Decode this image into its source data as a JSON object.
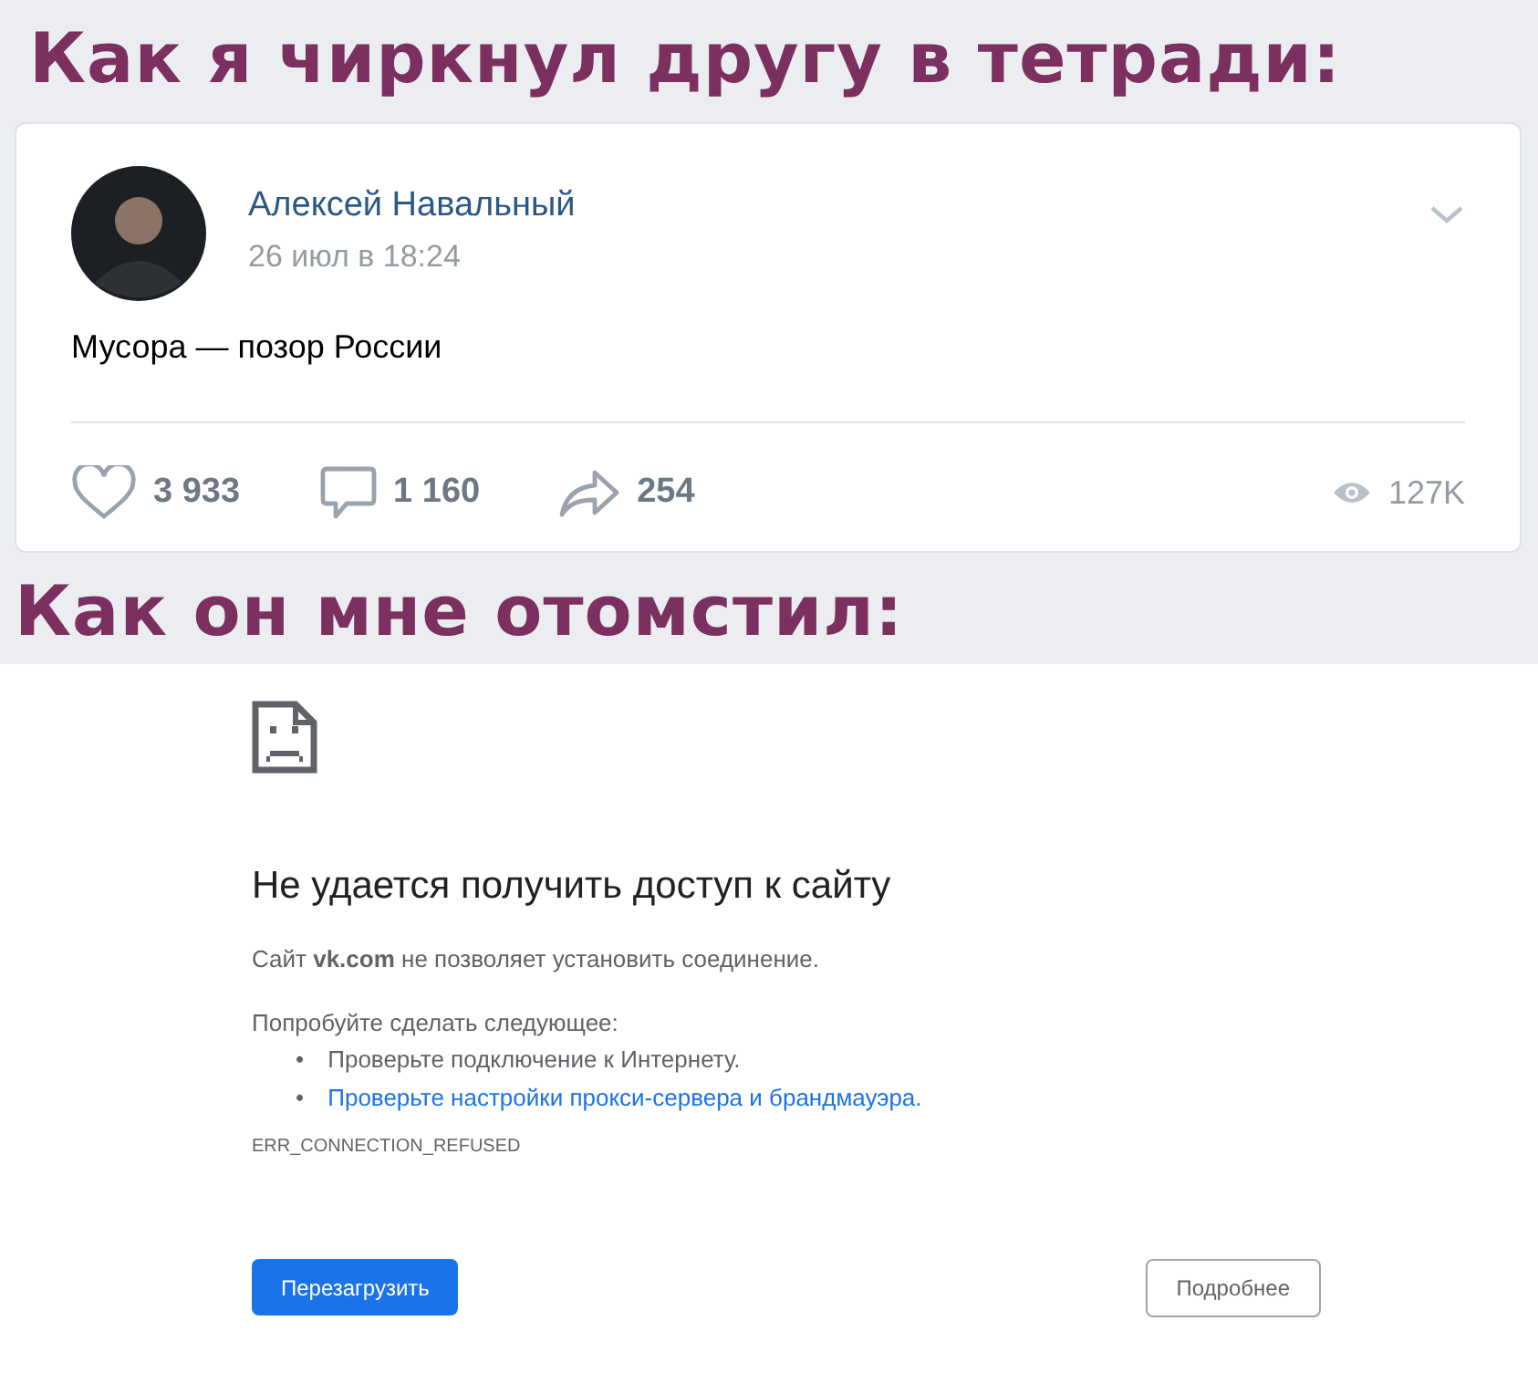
{
  "captions": [
    "Как я чиркнул другу в тетради:",
    "Как он мне отомстил:"
  ],
  "post": {
    "author": "Алексей Навальный",
    "date": "26 июл в 18:24",
    "text": "Мусора — позор России",
    "actions": [
      {
        "kind": "like",
        "count": "3 933"
      },
      {
        "kind": "comment",
        "count": "1 160"
      },
      {
        "kind": "share",
        "count": "254"
      }
    ],
    "views": "127K"
  },
  "error_page": {
    "title": "Не удается получить доступ к сайту",
    "message": "Сайт **vk.com** не позволяет установить соединение.",
    "suggestions_intro": "Попробуйте сделать следующее:",
    "suggestions": [
      {
        "marker": "•",
        "text": "Проверьте подключение к Интернету.",
        "kind": "text"
      },
      {
        "marker": "•",
        "text": "Проверьте настройки прокси-сервера и брандмауэра.",
        "kind": "link"
      }
    ],
    "code": "ERR_CONNECTION_REFUSED",
    "buttons": [
      {
        "label": "Перезагрузить",
        "kind": "primary"
      },
      {
        "label": "Подробнее",
        "kind": "secondary"
      }
    ]
  }
}
